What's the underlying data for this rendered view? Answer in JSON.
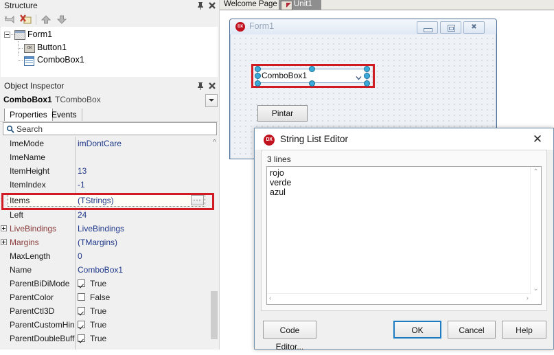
{
  "structure_panel": {
    "title": "Structure",
    "toolbar": [
      {
        "name": "remove-icon"
      },
      {
        "name": "error-icon"
      },
      {
        "name": "move-up-icon"
      },
      {
        "name": "move-down-icon"
      }
    ],
    "tree": [
      {
        "label": "Form1",
        "icon": "form-icon",
        "depth": 0,
        "expanded": true
      },
      {
        "label": "Button1",
        "icon": "button-icon",
        "depth": 1
      },
      {
        "label": "ComboBox1",
        "icon": "combobox-icon",
        "depth": 1
      }
    ]
  },
  "object_inspector": {
    "title": "Object Inspector",
    "object_name": "ComboBox1",
    "object_class": "TComboBox",
    "tabs": [
      {
        "label": "Properties",
        "active": true
      },
      {
        "label": "Events",
        "active": false
      }
    ],
    "search_placeholder": "Search",
    "properties": [
      {
        "name": "ImeMode",
        "value": "imDontCare",
        "type": "text",
        "blue": true
      },
      {
        "name": "ImeName",
        "value": "",
        "type": "text",
        "blue": true
      },
      {
        "name": "ItemHeight",
        "value": "13",
        "type": "text",
        "blue": true
      },
      {
        "name": "ItemIndex",
        "value": "-1",
        "type": "text",
        "blue": true
      },
      {
        "name": "Items",
        "value": "(TStrings)",
        "type": "editor",
        "selected": true,
        "blue": true
      },
      {
        "name": "Left",
        "value": "24",
        "type": "text",
        "blue": true
      },
      {
        "name": "LiveBindings",
        "value": "LiveBindings",
        "type": "text",
        "nested": true,
        "blue": true
      },
      {
        "name": "Margins",
        "value": "(TMargins)",
        "type": "text",
        "nested": true,
        "blue": true
      },
      {
        "name": "MaxLength",
        "value": "0",
        "type": "text",
        "blue": true
      },
      {
        "name": "Name",
        "value": "ComboBox1",
        "type": "text",
        "blue": true
      },
      {
        "name": "ParentBiDiMode",
        "value": "True",
        "type": "bool",
        "checked": true
      },
      {
        "name": "ParentColor",
        "value": "False",
        "type": "bool",
        "checked": false
      },
      {
        "name": "ParentCtl3D",
        "value": "True",
        "type": "bool",
        "checked": true
      },
      {
        "name": "ParentCustomHin",
        "value": "True",
        "type": "bool",
        "checked": true
      },
      {
        "name": "ParentDoubleBuff",
        "value": "True",
        "type": "bool",
        "checked": true
      }
    ],
    "ellipsis_button_label": "...",
    "highlight_color": "#cf1b21"
  },
  "editor_tabs": [
    {
      "label": "Welcome Page",
      "active": false
    },
    {
      "label": "Unit1",
      "active": true
    }
  ],
  "form_designer": {
    "form_title": "Form1",
    "app_icon_label": "DX",
    "window_buttons": [
      {
        "name": "minimize-button"
      },
      {
        "name": "maximize-button"
      },
      {
        "name": "close-button",
        "glyph": "✖"
      }
    ],
    "combobox": {
      "text": "ComboBox1",
      "selected": true
    },
    "button": {
      "label": "Pintar"
    }
  },
  "dialog": {
    "title": "String List Editor",
    "app_icon_label": "DX",
    "close_glyph": "✕",
    "lines_label": "3 lines",
    "lines": [
      "rojo",
      "verde",
      "azul"
    ],
    "buttons": {
      "code_editor": "Code Editor...",
      "ok": "OK",
      "cancel": "Cancel",
      "help": "Help"
    },
    "default_button": "OK",
    "scroll_up_glyph": "⌃",
    "scroll_down_glyph": "⌄",
    "scroll_left_glyph": "‹",
    "scroll_right_glyph": "›"
  }
}
